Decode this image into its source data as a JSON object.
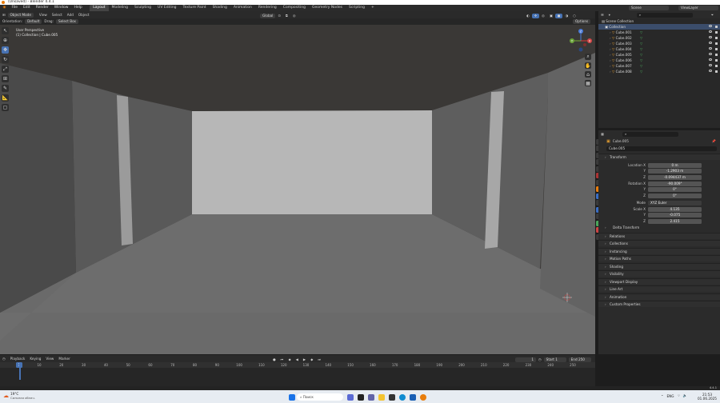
{
  "window": {
    "title": "(Unsaved) - Blender 4.4.1"
  },
  "menubar": {
    "menus": [
      "File",
      "Edit",
      "Render",
      "Window",
      "Help"
    ],
    "workspaces": [
      "Layout",
      "Modeling",
      "Sculpting",
      "UV Editing",
      "Texture Paint",
      "Shading",
      "Animation",
      "Rendering",
      "Compositing",
      "Geometry Nodes",
      "Scripting"
    ],
    "active_workspace": "Layout",
    "scene_label": "Scene",
    "viewlayer_label": "ViewLayer"
  },
  "viewport_header": {
    "mode": "Object Mode",
    "menus": [
      "View",
      "Select",
      "Add",
      "Object"
    ],
    "transform_orientation": "Global",
    "options_label": "Options",
    "orientation_label": "Orientation:",
    "orientation_value": "Default",
    "drag_label": "Drag:",
    "drag_value": "Select Box"
  },
  "viewport": {
    "perspective_label": "User Perspective",
    "collection_label": "(1) Collection | Cube.005",
    "gizmo": {
      "x": "X",
      "y": "Y",
      "z": "Z"
    }
  },
  "outliner": {
    "search_placeholder": "",
    "root": "Scene Collection",
    "collection": "Collection",
    "items": [
      "Cube.001",
      "Cube.002",
      "Cube.003",
      "Cube.004",
      "Cube.005",
      "Cube.006",
      "Cube.007",
      "Cube.008"
    ]
  },
  "properties": {
    "search_placeholder": "",
    "object_name": "Cube.005",
    "object_field": "Cube.005",
    "transform_title": "Transform",
    "location": {
      "label_x": "Location X",
      "label_y": "Y",
      "label_z": "Z",
      "x": "0 m",
      "y": "-1.2903 m",
      "z": "-0.094437 m"
    },
    "rotation": {
      "label_x": "Rotation X",
      "label_y": "Y",
      "label_z": "Z",
      "x": "-90.009°",
      "y": "0°",
      "z": "0°"
    },
    "mode_label": "Mode",
    "mode_value": "XYZ Euler",
    "scale": {
      "label_x": "Scale X",
      "label_y": "Y",
      "label_z": "Z",
      "x": "4.135",
      "y": "-0.075",
      "z": "2.415"
    },
    "delta_transform": "Delta Transform",
    "panels": [
      "Relations",
      "Collections",
      "Instancing",
      "Motion Paths",
      "Shading",
      "Visibility",
      "Viewport Display",
      "Line Art",
      "Animation",
      "Custom Properties"
    ]
  },
  "timeline": {
    "menus": [
      "Playback",
      "Keying",
      "View",
      "Marker"
    ],
    "current_frame": "1",
    "start_label": "Start",
    "start_value": "1",
    "end_label": "End",
    "end_value": "250",
    "ruler": [
      "1",
      "10",
      "20",
      "30",
      "40",
      "50",
      "60",
      "70",
      "80",
      "90",
      "100",
      "110",
      "120",
      "130",
      "140",
      "150",
      "160",
      "170",
      "180",
      "190",
      "200",
      "210",
      "220",
      "230",
      "240",
      "250"
    ]
  },
  "statusbar": {
    "version": "4.4.1"
  },
  "taskbar": {
    "weather_temp": "19°C",
    "weather_desc": "Сильная облач.",
    "search_placeholder": "Поиск",
    "lang": "ENG",
    "time": "21:53",
    "date": "01.06.2025"
  },
  "colors": {
    "accent": "#4772b3",
    "blender_orange": "#e87d0d",
    "viewport_bg": "#3c3a38",
    "mesh_green": "#4aa55c"
  }
}
